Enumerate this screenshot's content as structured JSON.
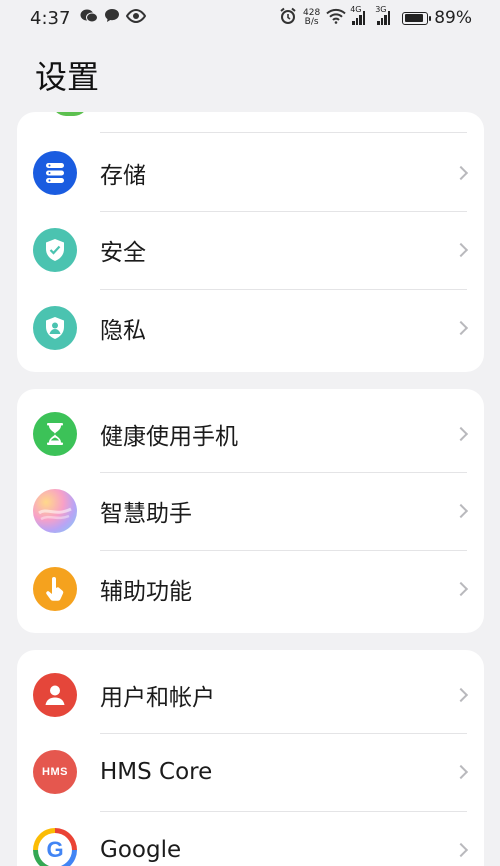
{
  "status_bar": {
    "time": "4:37",
    "net_speed_value": "428",
    "net_speed_unit": "B/s",
    "signal1_tag": "4G",
    "signal2_tag": "3G",
    "battery_percent": "89%",
    "battery_level": 0.89
  },
  "page": {
    "title": "设置"
  },
  "groups": [
    {
      "items": [
        {
          "label": "存储",
          "icon": "storage-icon",
          "color": "#1a5ce0"
        },
        {
          "label": "安全",
          "icon": "security-shield-icon",
          "color": "#4bc3b0"
        },
        {
          "label": "隐私",
          "icon": "privacy-icon",
          "color": "#4bc3b0"
        }
      ]
    },
    {
      "items": [
        {
          "label": "健康使用手机",
          "icon": "hourglass-icon",
          "color": "#3cc258"
        },
        {
          "label": "智慧助手",
          "icon": "assistant-icon",
          "color": "#e8a0e0"
        },
        {
          "label": "辅助功能",
          "icon": "accessibility-hand-icon",
          "color": "#f5a21e"
        }
      ]
    },
    {
      "items": [
        {
          "label": "用户和帐户",
          "icon": "user-icon",
          "color": "#e5463a"
        },
        {
          "label": "HMS Core",
          "icon": "hms-core-icon",
          "icon_text": "HMS",
          "color": "#e5574e"
        },
        {
          "label": "Google",
          "icon": "google-icon",
          "icon_text": "G",
          "color": "#4285f4"
        }
      ]
    }
  ]
}
